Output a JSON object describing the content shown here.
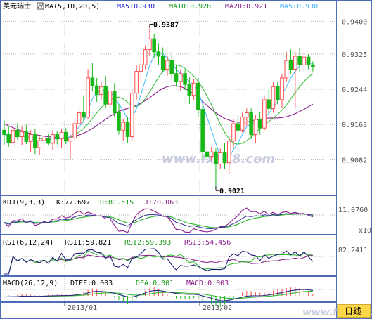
{
  "colors": {
    "background": "#ffffff",
    "panel_border": "#4d6db8",
    "grid": "#b5b5b5",
    "candle_up": "#ff4a4a",
    "candle_down": "#19b819",
    "ma5": "#49c0ff",
    "ma10": "#3fbf3f",
    "ma20": "#8a1e8a",
    "kdj_k": "#3a3a9a",
    "kdj_d": "#2fb82f",
    "kdj_j": "#8a1e8a",
    "rsi1": "#1e1e78",
    "rsi2": "#2fb82f",
    "rsi3": "#8a1e8a",
    "macd_diff": "#2a2a80",
    "macd_dea": "#2fb82f",
    "title_text": "#000000",
    "axis_text": "#505050",
    "period_button_bg": "#ffd84a",
    "watermark": "#c8cce0"
  },
  "main_panel": {
    "title": "美元瑞士",
    "indicator": "MA(5,10,20,5)",
    "ma5_label": "MA5:0.930",
    "ma10_label": "MA10:0.928",
    "ma20_label": "MA20:0.921",
    "ma5b_label": "MA5:0.930"
  },
  "kdj_panel": {
    "indicator": "KDJ(9,3,3)",
    "k_label": "K:77.697",
    "d_label": "D:81.515",
    "j_label": "J:70.063",
    "axis_value": "11.0760",
    "scale_label": "x10"
  },
  "rsi_panel": {
    "indicator": "RSI(6,12,24)",
    "rsi1_label": "RSI1:59.821",
    "rsi2_label": "RSI2:59.393",
    "rsi3_label": "RSI3:54.456",
    "axis_value": "82.2411"
  },
  "macd_panel": {
    "indicator": "MACD(26,12,9)",
    "diff_label": "DIFF:0.003",
    "dea_label": "DEA:0.001",
    "macd_label": "MACD:0.003"
  },
  "x_axis": {
    "labels": [
      "2013/01",
      "2013/02"
    ]
  },
  "watermark_text": "www.fx678.com",
  "period_button_label": "日线",
  "chart_data": {
    "type": "candlestick",
    "title": "美元瑞士",
    "y_ticks": [
      0.94,
      0.9325,
      0.9244,
      0.9163,
      0.9082
    ],
    "y_tick_labels": [
      "0.9400",
      "0.9325",
      "0.9244",
      "0.9163",
      "0.9082"
    ],
    "ylim": [
      0.901,
      0.942
    ],
    "annotations": [
      {
        "label": "0.9387",
        "value": 0.9387
      },
      {
        "label": "0.9021",
        "value": 0.9021
      }
    ],
    "candles": [
      {
        "o": 0.915,
        "h": 0.9172,
        "l": 0.9116,
        "c": 0.914
      },
      {
        "o": 0.914,
        "h": 0.916,
        "l": 0.9112,
        "c": 0.9122
      },
      {
        "o": 0.9122,
        "h": 0.916,
        "l": 0.9104,
        "c": 0.915
      },
      {
        "o": 0.915,
        "h": 0.9166,
        "l": 0.9128,
        "c": 0.9135
      },
      {
        "o": 0.9135,
        "h": 0.9158,
        "l": 0.9115,
        "c": 0.9146
      },
      {
        "o": 0.9146,
        "h": 0.9162,
        "l": 0.9118,
        "c": 0.9124
      },
      {
        "o": 0.9124,
        "h": 0.915,
        "l": 0.91,
        "c": 0.914
      },
      {
        "o": 0.914,
        "h": 0.9152,
        "l": 0.9095,
        "c": 0.911
      },
      {
        "o": 0.911,
        "h": 0.9135,
        "l": 0.9092,
        "c": 0.9126
      },
      {
        "o": 0.9126,
        "h": 0.914,
        "l": 0.91,
        "c": 0.9132
      },
      {
        "o": 0.9132,
        "h": 0.9142,
        "l": 0.9115,
        "c": 0.912
      },
      {
        "o": 0.912,
        "h": 0.915,
        "l": 0.9105,
        "c": 0.914
      },
      {
        "o": 0.914,
        "h": 0.9148,
        "l": 0.9118,
        "c": 0.913
      },
      {
        "o": 0.913,
        "h": 0.9152,
        "l": 0.911,
        "c": 0.9145
      },
      {
        "o": 0.9145,
        "h": 0.9155,
        "l": 0.9118,
        "c": 0.9125
      },
      {
        "o": 0.9125,
        "h": 0.914,
        "l": 0.9085,
        "c": 0.9132
      },
      {
        "o": 0.9132,
        "h": 0.9175,
        "l": 0.9125,
        "c": 0.9165
      },
      {
        "o": 0.9165,
        "h": 0.92,
        "l": 0.9155,
        "c": 0.919
      },
      {
        "o": 0.919,
        "h": 0.923,
        "l": 0.917,
        "c": 0.918
      },
      {
        "o": 0.918,
        "h": 0.929,
        "l": 0.9175,
        "c": 0.927
      },
      {
        "o": 0.927,
        "h": 0.9305,
        "l": 0.924,
        "c": 0.9252
      },
      {
        "o": 0.9252,
        "h": 0.927,
        "l": 0.9215,
        "c": 0.9232
      },
      {
        "o": 0.9232,
        "h": 0.9262,
        "l": 0.922,
        "c": 0.925
      },
      {
        "o": 0.925,
        "h": 0.9275,
        "l": 0.92,
        "c": 0.921
      },
      {
        "o": 0.921,
        "h": 0.925,
        "l": 0.9195,
        "c": 0.924
      },
      {
        "o": 0.924,
        "h": 0.9258,
        "l": 0.918,
        "c": 0.919
      },
      {
        "o": 0.919,
        "h": 0.921,
        "l": 0.914,
        "c": 0.915
      },
      {
        "o": 0.915,
        "h": 0.9175,
        "l": 0.9125,
        "c": 0.9168
      },
      {
        "o": 0.9168,
        "h": 0.918,
        "l": 0.912,
        "c": 0.9135
      },
      {
        "o": 0.9135,
        "h": 0.9245,
        "l": 0.9125,
        "c": 0.9235
      },
      {
        "o": 0.9235,
        "h": 0.93,
        "l": 0.922,
        "c": 0.9285
      },
      {
        "o": 0.9285,
        "h": 0.932,
        "l": 0.926,
        "c": 0.93
      },
      {
        "o": 0.93,
        "h": 0.9345,
        "l": 0.929,
        "c": 0.9335
      },
      {
        "o": 0.9335,
        "h": 0.9387,
        "l": 0.932,
        "c": 0.936
      },
      {
        "o": 0.936,
        "h": 0.9372,
        "l": 0.9315,
        "c": 0.933
      },
      {
        "o": 0.933,
        "h": 0.935,
        "l": 0.93,
        "c": 0.932
      },
      {
        "o": 0.932,
        "h": 0.934,
        "l": 0.9282,
        "c": 0.929
      },
      {
        "o": 0.929,
        "h": 0.932,
        "l": 0.9275,
        "c": 0.931
      },
      {
        "o": 0.931,
        "h": 0.933,
        "l": 0.9265,
        "c": 0.928
      },
      {
        "o": 0.928,
        "h": 0.93,
        "l": 0.925,
        "c": 0.9262
      },
      {
        "o": 0.9262,
        "h": 0.929,
        "l": 0.924,
        "c": 0.928
      },
      {
        "o": 0.928,
        "h": 0.929,
        "l": 0.9242,
        "c": 0.9255
      },
      {
        "o": 0.9255,
        "h": 0.9272,
        "l": 0.921,
        "c": 0.923
      },
      {
        "o": 0.923,
        "h": 0.9268,
        "l": 0.922,
        "c": 0.9258
      },
      {
        "o": 0.9258,
        "h": 0.927,
        "l": 0.918,
        "c": 0.9198
      },
      {
        "o": 0.9198,
        "h": 0.921,
        "l": 0.9082,
        "c": 0.91
      },
      {
        "o": 0.91,
        "h": 0.912,
        "l": 0.9075,
        "c": 0.909
      },
      {
        "o": 0.909,
        "h": 0.9112,
        "l": 0.908,
        "c": 0.91
      },
      {
        "o": 0.91,
        "h": 0.9108,
        "l": 0.9021,
        "c": 0.9072
      },
      {
        "o": 0.9072,
        "h": 0.9108,
        "l": 0.906,
        "c": 0.9098
      },
      {
        "o": 0.9098,
        "h": 0.912,
        "l": 0.906,
        "c": 0.9075
      },
      {
        "o": 0.9075,
        "h": 0.9135,
        "l": 0.905,
        "c": 0.9125
      },
      {
        "o": 0.9125,
        "h": 0.9175,
        "l": 0.911,
        "c": 0.9165
      },
      {
        "o": 0.9165,
        "h": 0.9185,
        "l": 0.914,
        "c": 0.915
      },
      {
        "o": 0.915,
        "h": 0.919,
        "l": 0.9145,
        "c": 0.918
      },
      {
        "o": 0.918,
        "h": 0.92,
        "l": 0.916,
        "c": 0.919
      },
      {
        "o": 0.919,
        "h": 0.92,
        "l": 0.913,
        "c": 0.914
      },
      {
        "o": 0.914,
        "h": 0.9185,
        "l": 0.912,
        "c": 0.9175
      },
      {
        "o": 0.9175,
        "h": 0.9192,
        "l": 0.914,
        "c": 0.9155
      },
      {
        "o": 0.9155,
        "h": 0.923,
        "l": 0.915,
        "c": 0.922
      },
      {
        "o": 0.922,
        "h": 0.9245,
        "l": 0.9188,
        "c": 0.92
      },
      {
        "o": 0.92,
        "h": 0.926,
        "l": 0.919,
        "c": 0.925
      },
      {
        "o": 0.925,
        "h": 0.9262,
        "l": 0.921,
        "c": 0.922
      },
      {
        "o": 0.922,
        "h": 0.928,
        "l": 0.92,
        "c": 0.927
      },
      {
        "o": 0.927,
        "h": 0.933,
        "l": 0.9262,
        "c": 0.931
      },
      {
        "o": 0.931,
        "h": 0.9335,
        "l": 0.928,
        "c": 0.929
      },
      {
        "o": 0.929,
        "h": 0.933,
        "l": 0.92,
        "c": 0.932
      },
      {
        "o": 0.932,
        "h": 0.9338,
        "l": 0.9282,
        "c": 0.93
      },
      {
        "o": 0.93,
        "h": 0.933,
        "l": 0.9285,
        "c": 0.9318
      },
      {
        "o": 0.9318,
        "h": 0.9325,
        "l": 0.929,
        "c": 0.93
      },
      {
        "o": 0.93,
        "h": 0.9308,
        "l": 0.9285,
        "c": 0.9296
      }
    ],
    "ma5": [
      0.914,
      0.9138,
      0.9136,
      0.9135,
      0.9138,
      0.9134,
      0.9131,
      0.9126,
      0.9124,
      0.9126,
      0.9128,
      0.913,
      0.9131,
      0.9132,
      0.9133,
      0.9135,
      0.9145,
      0.9158,
      0.917,
      0.9196,
      0.9222,
      0.9236,
      0.924,
      0.9243,
      0.9238,
      0.9226,
      0.921,
      0.9195,
      0.9175,
      0.9178,
      0.92,
      0.9232,
      0.9265,
      0.93,
      0.932,
      0.933,
      0.9325,
      0.9315,
      0.9305,
      0.929,
      0.928,
      0.927,
      0.9262,
      0.9255,
      0.924,
      0.921,
      0.918,
      0.915,
      0.912,
      0.909,
      0.9085,
      0.909,
      0.9105,
      0.912,
      0.914,
      0.9158,
      0.9165,
      0.9168,
      0.917,
      0.9178,
      0.9188,
      0.9202,
      0.9215,
      0.9232,
      0.925,
      0.927,
      0.9285,
      0.9298,
      0.9306,
      0.9306,
      0.9302
    ],
    "ma10": [
      0.9142,
      0.914,
      0.9138,
      0.9137,
      0.9136,
      0.9135,
      0.9134,
      0.9132,
      0.9131,
      0.913,
      0.913,
      0.913,
      0.913,
      0.9131,
      0.9132,
      0.9134,
      0.9139,
      0.9146,
      0.9154,
      0.9165,
      0.9177,
      0.919,
      0.9202,
      0.9212,
      0.922,
      0.9225,
      0.9226,
      0.9222,
      0.9214,
      0.9206,
      0.9204,
      0.921,
      0.9222,
      0.9238,
      0.9255,
      0.9272,
      0.9285,
      0.9294,
      0.93,
      0.93,
      0.9298,
      0.9292,
      0.9284,
      0.9274,
      0.9262,
      0.9247,
      0.9228,
      0.9208,
      0.9186,
      0.9164,
      0.9145,
      0.913,
      0.912,
      0.9118,
      0.912,
      0.9126,
      0.9134,
      0.9144,
      0.9154,
      0.9162,
      0.917,
      0.9178,
      0.9186,
      0.9196,
      0.9208,
      0.9222,
      0.9236,
      0.925,
      0.9262,
      0.9272,
      0.928
    ],
    "ma20": [
      0.9165,
      0.916,
      0.9156,
      0.9152,
      0.9148,
      0.9145,
      0.9142,
      0.914,
      0.9138,
      0.9136,
      0.9135,
      0.9134,
      0.9133,
      0.9133,
      0.9133,
      0.9134,
      0.9136,
      0.9139,
      0.9143,
      0.9148,
      0.9154,
      0.9161,
      0.9168,
      0.9175,
      0.9182,
      0.9188,
      0.9193,
      0.9197,
      0.92,
      0.9203,
      0.9207,
      0.9212,
      0.9218,
      0.9225,
      0.9232,
      0.924,
      0.9246,
      0.925,
      0.9252,
      0.9252,
      0.925,
      0.9246,
      0.924,
      0.9233,
      0.9225,
      0.9216,
      0.9207,
      0.9198,
      0.919,
      0.9183,
      0.9177,
      0.9173,
      0.917,
      0.9168,
      0.9168,
      0.9169,
      0.9171,
      0.9173,
      0.9175,
      0.9177,
      0.9178,
      0.9178,
      0.9178,
      0.9179,
      0.9181,
      0.9184,
      0.9188,
      0.9193,
      0.9198,
      0.9204,
      0.921
    ]
  }
}
